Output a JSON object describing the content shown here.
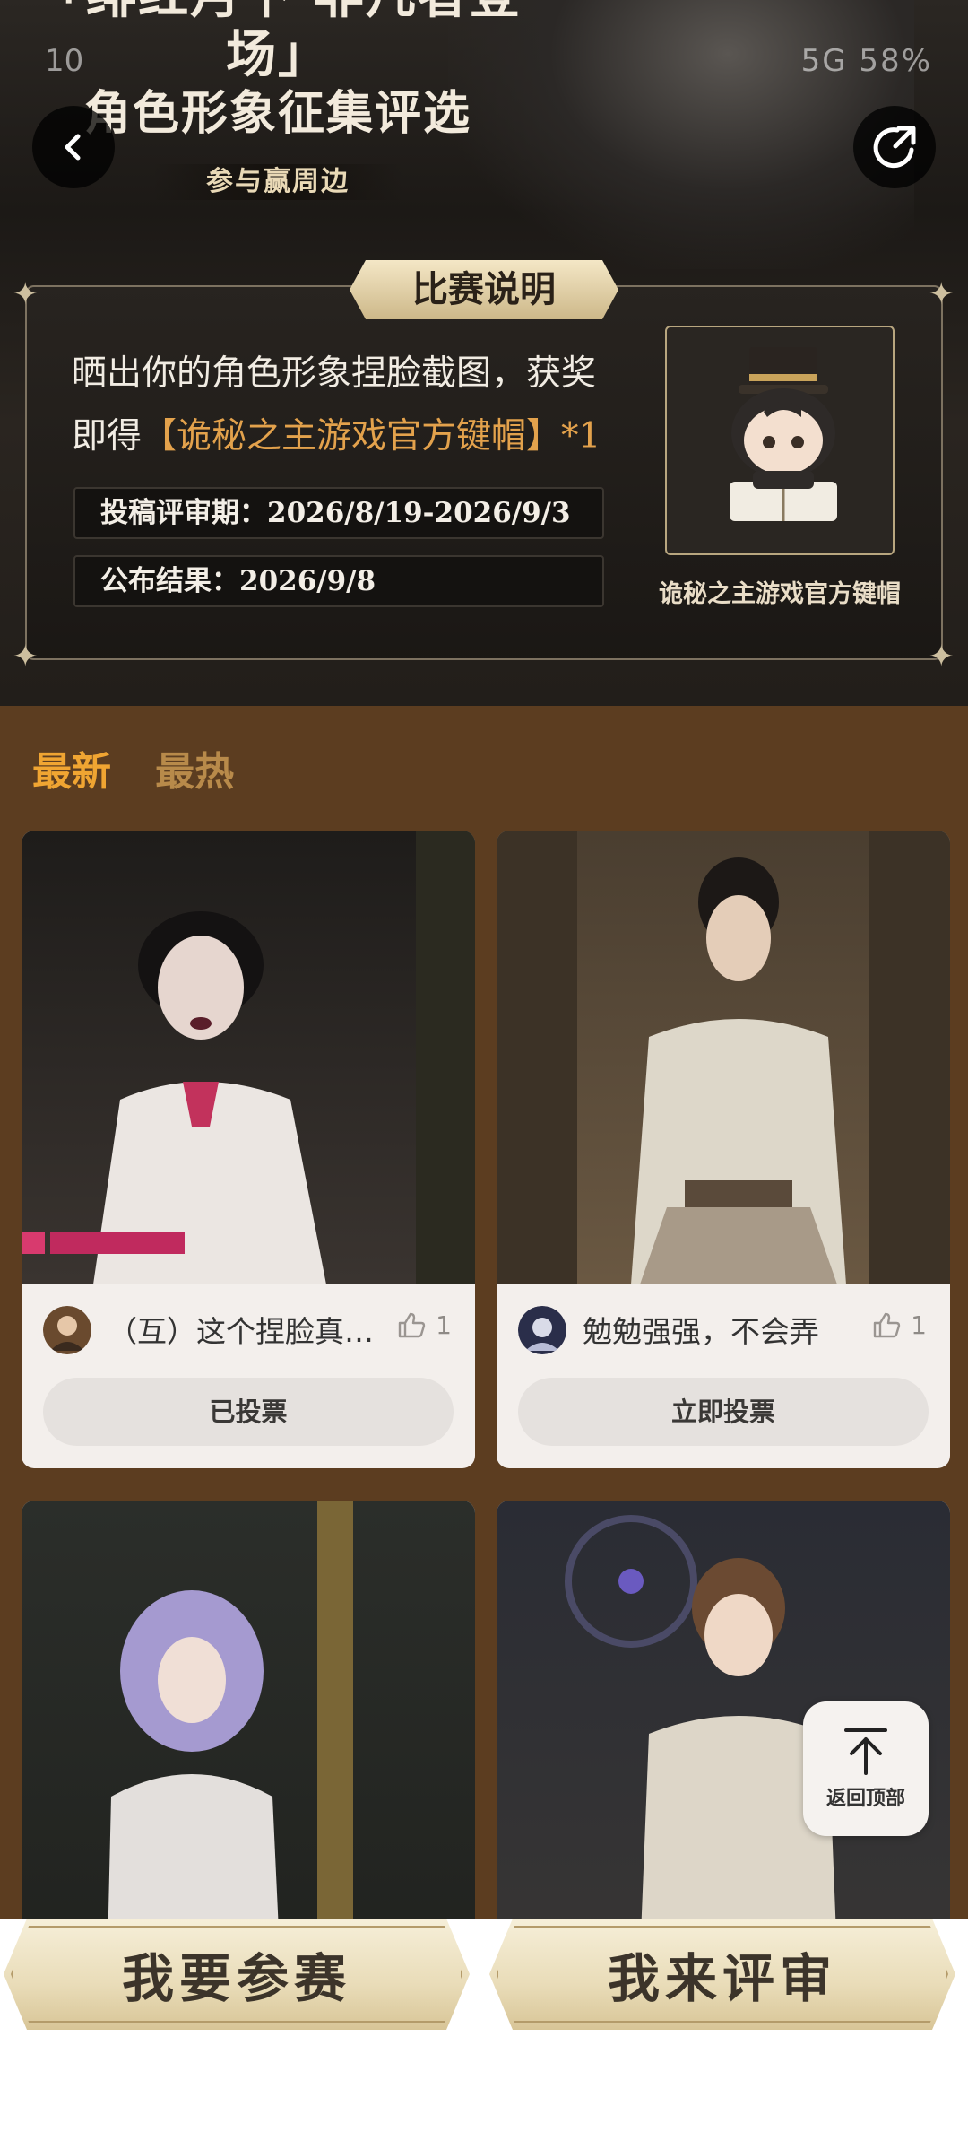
{
  "banner": {
    "title_line1": "「绯红月下·非凡者登场」",
    "title_line2": "角色形象征集评选",
    "subtitle": "参与赢周边"
  },
  "status_bar": {
    "time": "10",
    "indicators": "5G 58%"
  },
  "rules": {
    "title": "比赛说明",
    "desc_prefix": "晒出你的角色形象捏脸截图，获奖即得",
    "desc_highlight": "【诡秘之主游戏官方键帽】*1",
    "submission_period": "投稿评审期：2026/8/19-2026/9/3",
    "result_date": "公布结果：2026/9/8",
    "prize_label": "诡秘之主游戏官方键帽"
  },
  "tabs": [
    {
      "label": "最新",
      "active": true
    },
    {
      "label": "最热",
      "active": false
    }
  ],
  "entries": [
    {
      "title": "（互）这个捏脸真…",
      "likes": "1",
      "vote_label": "已投票"
    },
    {
      "title": "勉勉强强，不会弄",
      "likes": "1",
      "vote_label": "立即投票"
    },
    {
      "title": "",
      "likes": "",
      "vote_label": ""
    },
    {
      "title": "",
      "likes": "",
      "vote_label": ""
    }
  ],
  "back_to_top": "返回顶部",
  "actions": {
    "join": "我要参赛",
    "judge": "我来评审"
  },
  "colors": {
    "page_bg": "#5c3d20",
    "accent": "#f0a532",
    "highlight": "#e3a24c"
  }
}
